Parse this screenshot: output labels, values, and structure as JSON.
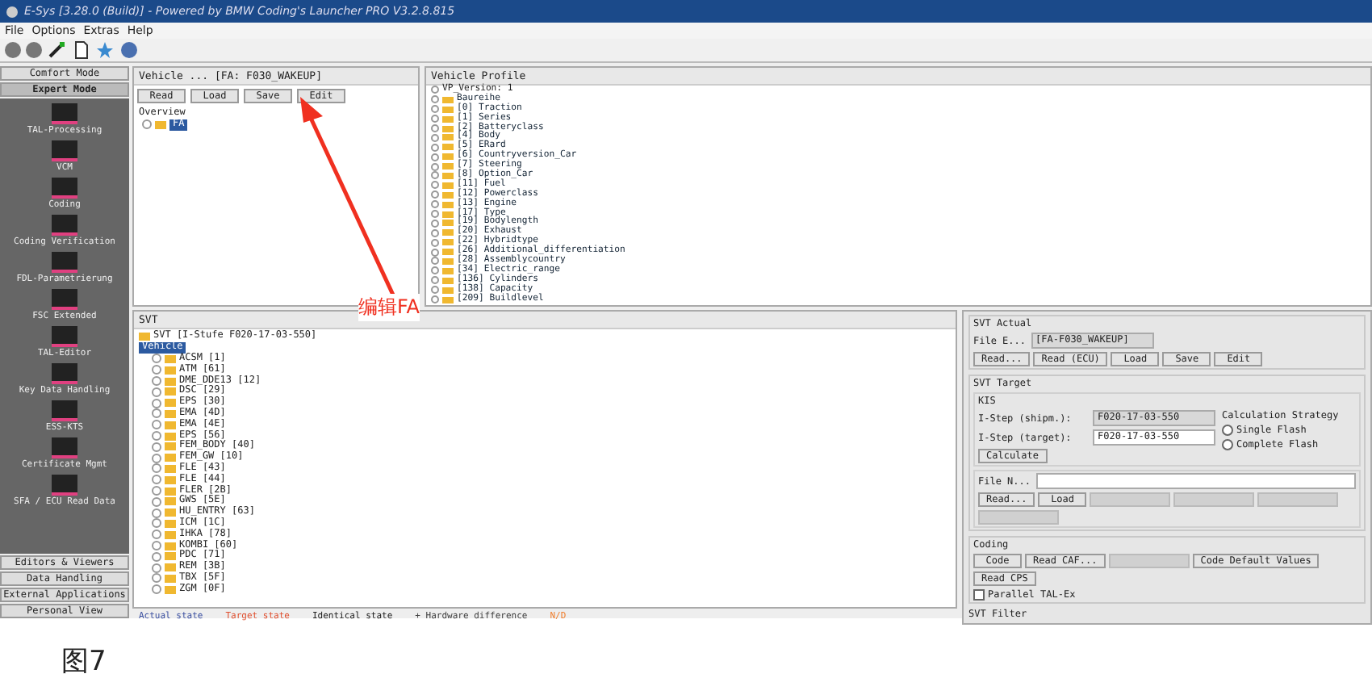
{
  "window": {
    "title": "E-Sys [3.28.0 (Build)] - Powered by BMW Coding's Launcher PRO V3.2.8.815"
  },
  "menu": [
    "File",
    "Options",
    "Extras",
    "Help"
  ],
  "sidebar": {
    "mode_buttons": [
      {
        "label": "Comfort Mode",
        "selected": false
      },
      {
        "label": "Expert Mode",
        "selected": true
      }
    ],
    "items": [
      "TAL-Processing",
      "VCM",
      "Coding",
      "Coding Verification",
      "FDL-Parametrierung",
      "FSC Extended",
      "TAL-Editor",
      "Key Data Handling",
      "ESS-KTS",
      "Certificate Mgmt",
      "SFA / ECU Read Data"
    ],
    "bottom_buttons": [
      "Editors & Viewers",
      "Data Handling",
      "External Applications",
      "Personal View"
    ]
  },
  "vehicle": {
    "title": "Vehicle ... [FA: F030_WAKEUP]",
    "buttons": [
      "Read",
      "Load",
      "Save",
      "Edit"
    ],
    "tree": [
      {
        "label": "Overview",
        "selected": false,
        "children": [
          {
            "label": "FA",
            "selected": true
          }
        ]
      }
    ]
  },
  "profile": {
    "title": "Vehicle Profile",
    "root": "VP_Version: 1",
    "group": "Baureihe",
    "items": [
      "[0] Traction",
      "[1] Series",
      "[2] Batteryclass",
      "[4] Body",
      "[5] ERard",
      "[6] Countryversion_Car",
      "[7] Steering",
      "[8] Option_Car",
      "[11] Fuel",
      "[12] Powerclass",
      "[13] Engine",
      "[17] Type",
      "[19] Bodylength",
      "[20] Exhaust",
      "[22] Hybridtype",
      "[26] Additional_differentiation",
      "[28] Assemblycountry",
      "[34] Electric_range",
      "[136] Cylinders",
      "[138] Capacity",
      "[209] Buildlevel"
    ]
  },
  "svt": {
    "title": "SVT",
    "root": "SVT [I-Stufe F020-17-03-550]",
    "vehicle": {
      "label": "Vehicle",
      "selected": true
    },
    "ecus": [
      "ACSM [1]",
      "ATM [61]",
      "DME_DDE13 [12]",
      "DSC [29]",
      "EPS [30]",
      "EMA [4D]",
      "EMA [4E]",
      "EPS [56]",
      "FEM_BODY [40]",
      "FEM_GW [10]",
      "FLE [43]",
      "FLE [44]",
      "FLER [2B]",
      "GWS [5E]",
      "HU_ENTRY [63]",
      "ICM [1C]",
      "IHKA [78]",
      "KOMBI [60]",
      "PDC [71]",
      "REM [3B]",
      "TBX [5F]",
      "ZGM [0F]"
    ]
  },
  "legend": [
    {
      "label": "Actual state",
      "color": "#3a4fa0"
    },
    {
      "label": "Target state",
      "color": "#e05030"
    },
    {
      "label": "Identical state",
      "color": "#202020"
    },
    {
      "label": "+ Hardware difference",
      "color": "#404040"
    },
    {
      "label": "N/D",
      "color": "#f08030"
    }
  ],
  "right": {
    "actual": {
      "title": "SVT Actual",
      "file_label": "File E...",
      "file_value": "[FA-F030_WAKEUP]",
      "buttons": [
        {
          "label": "Read...",
          "disabled": false
        },
        {
          "label": "Read (ECU)",
          "disabled": false
        },
        {
          "label": "Load",
          "disabled": false
        },
        {
          "label": "Save",
          "disabled": false
        },
        {
          "label": "Edit",
          "disabled": false
        }
      ]
    },
    "target": {
      "title": "SVT Target",
      "kis_title": "KIS",
      "shipm_label": "I-Step (shipm.):",
      "shipm_value": "F020-17-03-550",
      "target_label": "I-Step (target):",
      "target_value": "F020-17-03-550",
      "calc_button": "Calculate",
      "strategy_title": "Calculation Strategy",
      "strategies": [
        {
          "label": "Single Flash",
          "selected": false
        },
        {
          "label": "Complete Flash",
          "selected": false
        }
      ],
      "file_label": "File N...",
      "buttons": [
        {
          "label": "Read...",
          "disabled": false
        },
        {
          "label": "Load",
          "disabled": false
        },
        {
          "disabled": true
        },
        {
          "disabled": true
        },
        {
          "disabled": true
        },
        {
          "disabled": true
        }
      ]
    },
    "coding": {
      "title": "Coding",
      "buttons": [
        {
          "label": "Code",
          "disabled": false
        },
        {
          "label": "Read CAF...",
          "disabled": false
        },
        {
          "disabled": true
        },
        {
          "label": "Code Default Values",
          "disabled": false
        },
        {
          "label": "Read CPS",
          "disabled": false
        }
      ],
      "parallel": {
        "label": "Parallel TAL-Ex",
        "checked": false
      }
    },
    "filter_title": "SVT Filter"
  },
  "annotation": {
    "text": "编辑FA"
  },
  "caption": "图7"
}
